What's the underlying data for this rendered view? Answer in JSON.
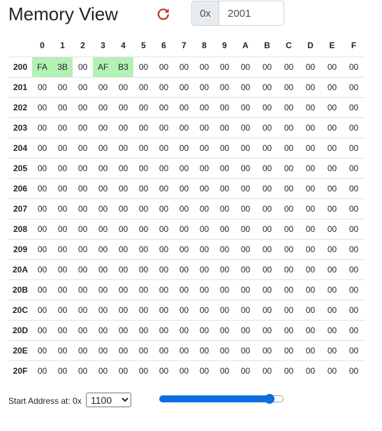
{
  "header": {
    "title": "Memory View",
    "refresh_icon": "refresh-icon",
    "refresh_color": "#c0392b",
    "address_prefix": "0x",
    "address_value": "2001"
  },
  "table": {
    "columns": [
      "0",
      "1",
      "2",
      "3",
      "4",
      "5",
      "6",
      "7",
      "8",
      "9",
      "A",
      "B",
      "C",
      "D",
      "E",
      "F"
    ],
    "highlight_color": "#b3f2b3",
    "rows": [
      {
        "addr": "200",
        "cells": [
          "FA",
          "3B",
          "00",
          "AF",
          "B3",
          "00",
          "00",
          "00",
          "00",
          "00",
          "00",
          "00",
          "00",
          "00",
          "00",
          "00"
        ],
        "highlight": [
          0,
          1,
          3,
          4
        ]
      },
      {
        "addr": "201",
        "cells": [
          "00",
          "00",
          "00",
          "00",
          "00",
          "00",
          "00",
          "00",
          "00",
          "00",
          "00",
          "00",
          "00",
          "00",
          "00",
          "00"
        ],
        "highlight": []
      },
      {
        "addr": "202",
        "cells": [
          "00",
          "00",
          "00",
          "00",
          "00",
          "00",
          "00",
          "00",
          "00",
          "00",
          "00",
          "00",
          "00",
          "00",
          "00",
          "00"
        ],
        "highlight": []
      },
      {
        "addr": "203",
        "cells": [
          "00",
          "00",
          "00",
          "00",
          "00",
          "00",
          "00",
          "00",
          "00",
          "00",
          "00",
          "00",
          "00",
          "00",
          "00",
          "00"
        ],
        "highlight": []
      },
      {
        "addr": "204",
        "cells": [
          "00",
          "00",
          "00",
          "00",
          "00",
          "00",
          "00",
          "00",
          "00",
          "00",
          "00",
          "00",
          "00",
          "00",
          "00",
          "00"
        ],
        "highlight": []
      },
      {
        "addr": "205",
        "cells": [
          "00",
          "00",
          "00",
          "00",
          "00",
          "00",
          "00",
          "00",
          "00",
          "00",
          "00",
          "00",
          "00",
          "00",
          "00",
          "00"
        ],
        "highlight": []
      },
      {
        "addr": "206",
        "cells": [
          "00",
          "00",
          "00",
          "00",
          "00",
          "00",
          "00",
          "00",
          "00",
          "00",
          "00",
          "00",
          "00",
          "00",
          "00",
          "00"
        ],
        "highlight": []
      },
      {
        "addr": "207",
        "cells": [
          "00",
          "00",
          "00",
          "00",
          "00",
          "00",
          "00",
          "00",
          "00",
          "00",
          "00",
          "00",
          "00",
          "00",
          "00",
          "00"
        ],
        "highlight": []
      },
      {
        "addr": "208",
        "cells": [
          "00",
          "00",
          "00",
          "00",
          "00",
          "00",
          "00",
          "00",
          "00",
          "00",
          "00",
          "00",
          "00",
          "00",
          "00",
          "00"
        ],
        "highlight": []
      },
      {
        "addr": "209",
        "cells": [
          "00",
          "00",
          "00",
          "00",
          "00",
          "00",
          "00",
          "00",
          "00",
          "00",
          "00",
          "00",
          "00",
          "00",
          "00",
          "00"
        ],
        "highlight": []
      },
      {
        "addr": "20A",
        "cells": [
          "00",
          "00",
          "00",
          "00",
          "00",
          "00",
          "00",
          "00",
          "00",
          "00",
          "00",
          "00",
          "00",
          "00",
          "00",
          "00"
        ],
        "highlight": []
      },
      {
        "addr": "20B",
        "cells": [
          "00",
          "00",
          "00",
          "00",
          "00",
          "00",
          "00",
          "00",
          "00",
          "00",
          "00",
          "00",
          "00",
          "00",
          "00",
          "00"
        ],
        "highlight": []
      },
      {
        "addr": "20C",
        "cells": [
          "00",
          "00",
          "00",
          "00",
          "00",
          "00",
          "00",
          "00",
          "00",
          "00",
          "00",
          "00",
          "00",
          "00",
          "00",
          "00"
        ],
        "highlight": []
      },
      {
        "addr": "20D",
        "cells": [
          "00",
          "00",
          "00",
          "00",
          "00",
          "00",
          "00",
          "00",
          "00",
          "00",
          "00",
          "00",
          "00",
          "00",
          "00",
          "00"
        ],
        "highlight": []
      },
      {
        "addr": "20E",
        "cells": [
          "00",
          "00",
          "00",
          "00",
          "00",
          "00",
          "00",
          "00",
          "00",
          "00",
          "00",
          "00",
          "00",
          "00",
          "00",
          "00"
        ],
        "highlight": []
      },
      {
        "addr": "20F",
        "cells": [
          "00",
          "00",
          "00",
          "00",
          "00",
          "00",
          "00",
          "00",
          "00",
          "00",
          "00",
          "00",
          "00",
          "00",
          "00",
          "00"
        ],
        "highlight": []
      }
    ]
  },
  "footer": {
    "start_label": "Start Address at: 0x",
    "start_options": [
      "1100"
    ],
    "start_selected": "1100",
    "slider_fraction": 0.92,
    "slider_color": "#0b6fe0"
  }
}
